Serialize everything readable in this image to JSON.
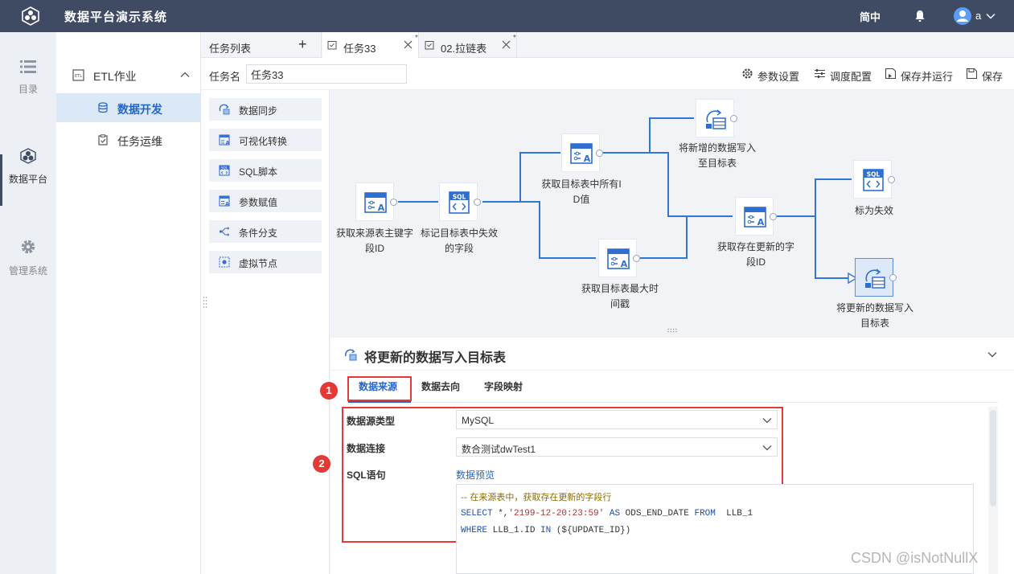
{
  "app": {
    "title": "数据平台演示系统",
    "lang": "简中",
    "user": "a"
  },
  "rail": [
    {
      "label": "目录",
      "icon": "list-icon"
    },
    {
      "label": "数据平台",
      "icon": "cubes-icon",
      "active": true
    },
    {
      "label": "管理系统",
      "icon": "gear-icon"
    }
  ],
  "submenu": {
    "group": "ETL作业",
    "items": [
      {
        "label": "数据开发",
        "active": true
      },
      {
        "label": "任务运维",
        "active": false
      }
    ]
  },
  "tabs": {
    "list_header": "任务列表",
    "plus": "+",
    "items": [
      {
        "label": "任务33",
        "modified": "*",
        "active": true
      },
      {
        "label": "02.拉链表",
        "modified": "*",
        "active": false
      }
    ]
  },
  "toolbar": {
    "task_name_label": "任务名",
    "task_name_value": "任务33",
    "buttons": [
      "参数设置",
      "调度配置",
      "保存并运行",
      "保存"
    ]
  },
  "palette": [
    "数据同步",
    "可视化转换",
    "SQL脚本",
    "参数赋值",
    "条件分支",
    "虚拟节点"
  ],
  "flow": {
    "nodes": [
      {
        "id": "n1",
        "type": "transform",
        "label_lines": [
          "获取来源表主键字",
          "段ID"
        ]
      },
      {
        "id": "n2",
        "type": "sql",
        "label_lines": [
          "标记目标表中失效",
          "的字段"
        ]
      },
      {
        "id": "n3",
        "type": "transform",
        "label_lines": [
          "获取目标表中所有I",
          "D值"
        ]
      },
      {
        "id": "n4",
        "type": "sync",
        "label_lines": [
          "将新增的数据写入",
          "至目标表"
        ]
      },
      {
        "id": "n5",
        "type": "transform",
        "label_lines": [
          "获取目标表最大时",
          "间戳"
        ]
      },
      {
        "id": "n6",
        "type": "transform",
        "label_lines": [
          "获取存在更新的字",
          "段ID"
        ]
      },
      {
        "id": "n7",
        "type": "sql",
        "label_lines": [
          "标为失效"
        ]
      },
      {
        "id": "n8",
        "type": "sync",
        "label_lines": [
          "将更新的数据写入",
          "目标表"
        ],
        "selected": true
      }
    ]
  },
  "detail": {
    "title": "将更新的数据写入目标表",
    "tabs": [
      "数据来源",
      "数据去向",
      "字段映射"
    ],
    "active_tab": "数据来源",
    "badges": [
      "1",
      "2"
    ],
    "source_type_label": "数据源类型",
    "source_type_value": "MySQL",
    "connection_label": "数据连接",
    "connection_value": "数合测试dwTest1",
    "sql_label": "SQL语句",
    "preview_link": "数据预览",
    "sql": {
      "comment": "-- 在来源表中，获取存在更新的字段行",
      "l2_kw1": "SELECT",
      "l2_plain1": " *,",
      "l2_str": "'2199-12-20:23:59'",
      "l2_kw2": " AS",
      "l2_plain2": " ODS_END_DATE ",
      "l2_kw3": "FROM",
      "l2_plain3": "  LLB_1",
      "l3_kw1": "WHERE",
      "l3_plain1": " LLB_1.ID ",
      "l3_kw2": "IN",
      "l3_plain2": " (${UPDATE_ID})"
    }
  },
  "watermark": "CSDN @isNotNullX",
  "colors": {
    "topbar": "#3f4a63",
    "accent": "#2366d1",
    "highlight": "#e53935",
    "edge": "#2f78d8"
  }
}
